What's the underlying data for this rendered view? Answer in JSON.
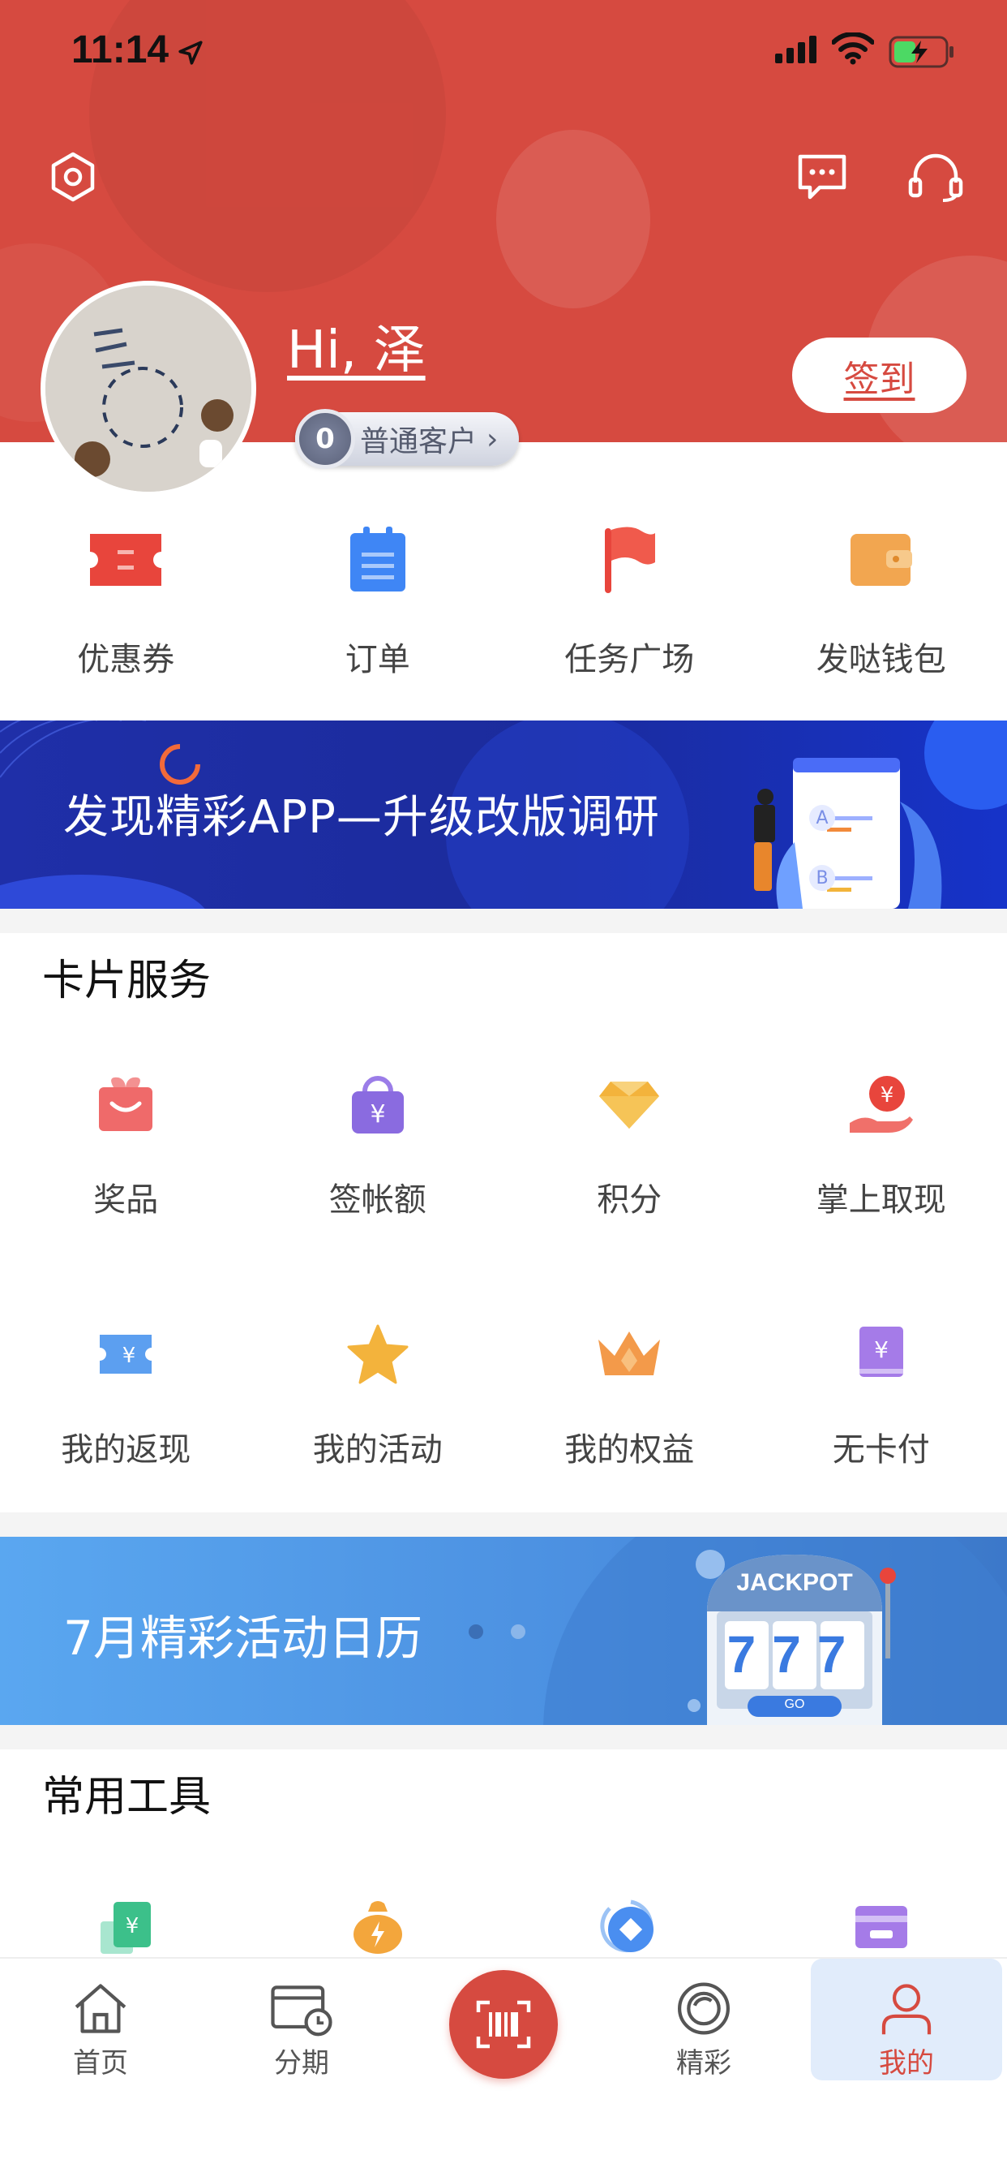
{
  "status_bar": {
    "time": "11:14"
  },
  "header": {
    "greeting": "Hi, 泽",
    "checkin_label": "签到",
    "level_number": "0",
    "level_label": "普通客户",
    "level_chevron": "›"
  },
  "quick_row": [
    {
      "label": "优惠券",
      "icon": "coupon-icon",
      "color": "#e8453c"
    },
    {
      "label": "订单",
      "icon": "order-icon",
      "color": "#3f86f5"
    },
    {
      "label": "任务广场",
      "icon": "flag-icon",
      "color": "#ef5a4e"
    },
    {
      "label": "发哒钱包",
      "icon": "wallet-icon",
      "color": "#f2a650"
    }
  ],
  "banner_survey": {
    "text": "发现精彩APP—升级改版调研",
    "option_a": "A",
    "option_b": "B"
  },
  "card_services": {
    "title": "卡片服务",
    "row1": [
      {
        "label": "奖品",
        "icon": "gift-icon"
      },
      {
        "label": "签帐额",
        "icon": "bag-icon"
      },
      {
        "label": "积分",
        "icon": "diamond-icon"
      },
      {
        "label": "掌上取现",
        "icon": "cash-hand-icon"
      }
    ],
    "row2": [
      {
        "label": "我的返现",
        "icon": "cashback-ticket-icon"
      },
      {
        "label": "我的活动",
        "icon": "star-icon"
      },
      {
        "label": "我的权益",
        "icon": "crown-icon"
      },
      {
        "label": "无卡付",
        "icon": "cardless-pay-icon"
      }
    ]
  },
  "banner_calendar": {
    "text": "7月精彩活动日历",
    "slot_title": "JACKPOT",
    "slot_digits": "777",
    "slot_go": "GO"
  },
  "common_tools": {
    "title": "常用工具"
  },
  "tab_bar": [
    {
      "label": "首页",
      "icon": "home-icon"
    },
    {
      "label": "分期",
      "icon": "installment-icon"
    },
    {
      "label": "",
      "icon": "barcode-scan-icon"
    },
    {
      "label": "精彩",
      "icon": "discover-icon"
    },
    {
      "label": "我的",
      "icon": "profile-icon"
    }
  ]
}
